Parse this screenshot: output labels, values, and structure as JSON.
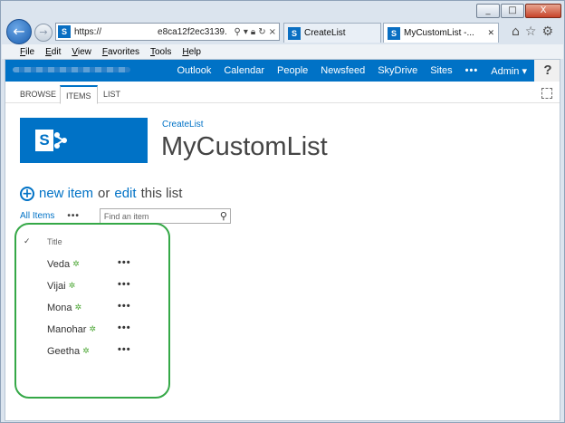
{
  "window": {
    "controls": [
      "_",
      "□",
      "X"
    ]
  },
  "browser": {
    "address_text": "https://",
    "address_suffix": "e8ca12f2ec3139.",
    "tabs": [
      {
        "label": "CreateList"
      },
      {
        "label": "MyCustomList -..."
      }
    ],
    "menu": [
      "File",
      "Edit",
      "View",
      "Favorites",
      "Tools",
      "Help"
    ]
  },
  "suitebar": {
    "links": [
      "Outlook",
      "Calendar",
      "People",
      "Newsfeed",
      "SkyDrive",
      "Sites"
    ],
    "more": "•••",
    "user": "Admin ▾",
    "help": "?"
  },
  "ribbon": {
    "tabs": [
      "BROWSE",
      "ITEMS",
      "LIST"
    ]
  },
  "site": {
    "logo_letter": "S",
    "breadcrumb": "CreateList",
    "title": "MyCustomList"
  },
  "toolbar": {
    "new_item": "new item",
    "or": "or",
    "edit": "edit",
    "this_list": "this list",
    "view_name": "All Items",
    "view_more": "•••",
    "search_placeholder": "Find an item"
  },
  "list": {
    "check_glyph": "✓",
    "column_title": "Title",
    "new_badge": "✲",
    "row_menu": "•••",
    "items": [
      "Veda",
      "Vijai",
      "Mona",
      "Manohar",
      "Geetha"
    ]
  },
  "colors": {
    "suite_blue": "#0072c6",
    "highlight_green": "#35a847"
  }
}
